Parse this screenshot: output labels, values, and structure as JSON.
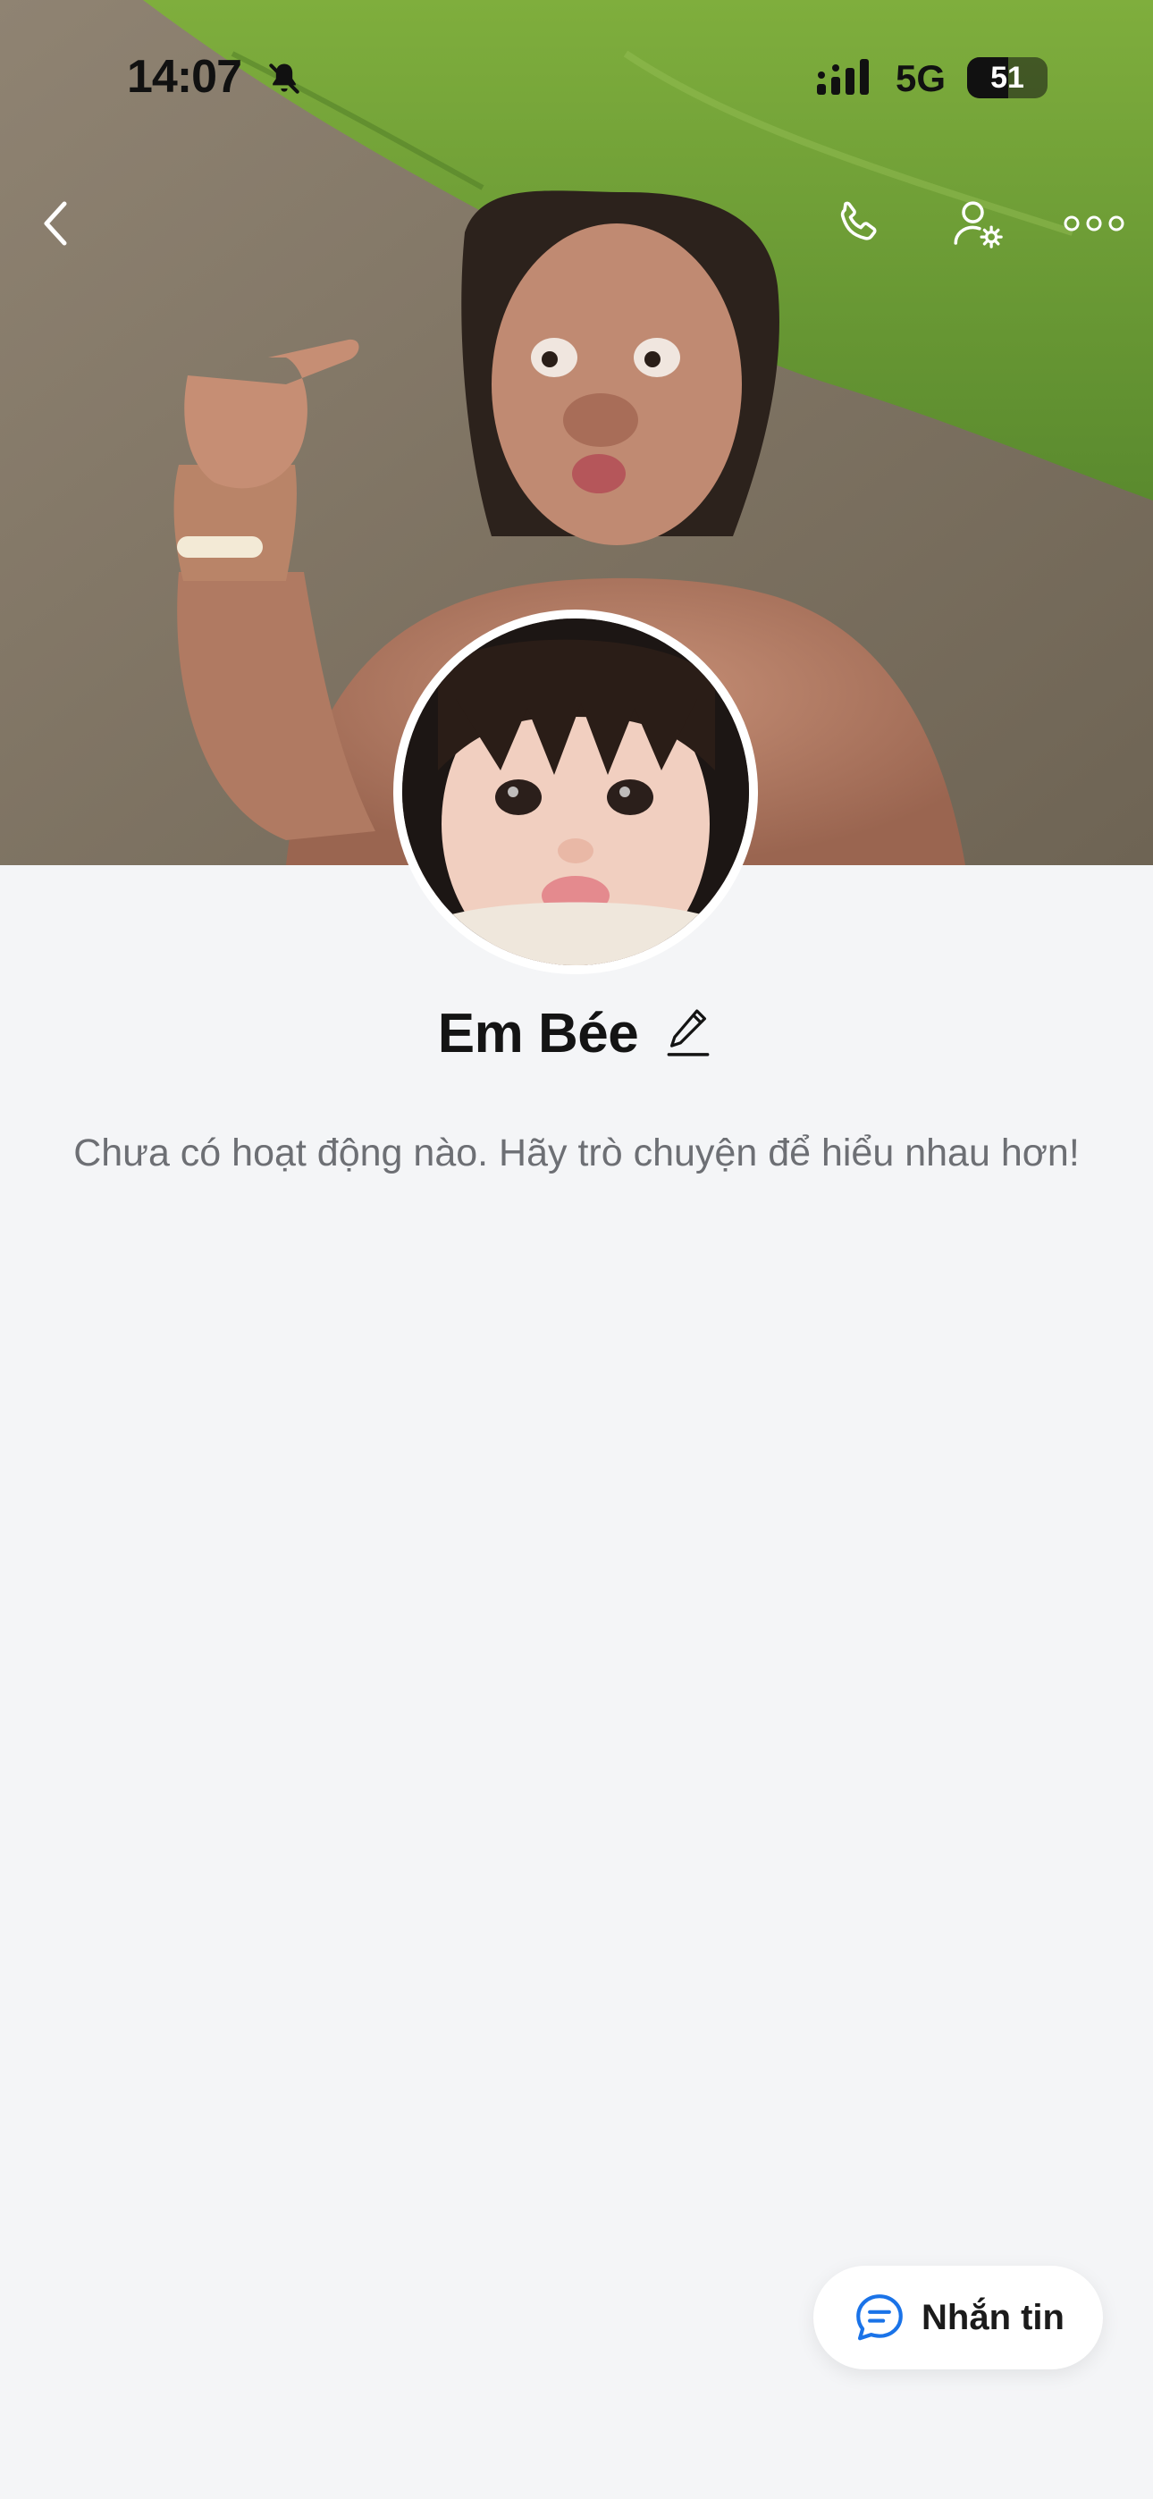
{
  "status_bar": {
    "time": "14:07",
    "network": "5G",
    "battery": "51",
    "battery_level_percent": 51,
    "icons": [
      "bell-slash-icon",
      "signal-icon",
      "battery-icon"
    ]
  },
  "top_nav": {
    "icons": [
      "back-chevron-icon",
      "phone-call-icon",
      "user-settings-icon",
      "more-dots-icon"
    ]
  },
  "profile": {
    "name": "Em Bée",
    "edit_icon": "pencil-icon"
  },
  "empty_state": {
    "text": "Chưa có hoạt động nào. Hãy trò chuyện để hiểu nhau hơn!"
  },
  "fab": {
    "label": "Nhắn tin",
    "icon": "chat-bubble-icon"
  },
  "colors": {
    "background": "#f4f5f7",
    "accent_blue": "#1a73e8",
    "muted_text": "#6d6f74",
    "cover_grass": "#6f9a3a",
    "cover_dirt": "#8a7e6c"
  }
}
